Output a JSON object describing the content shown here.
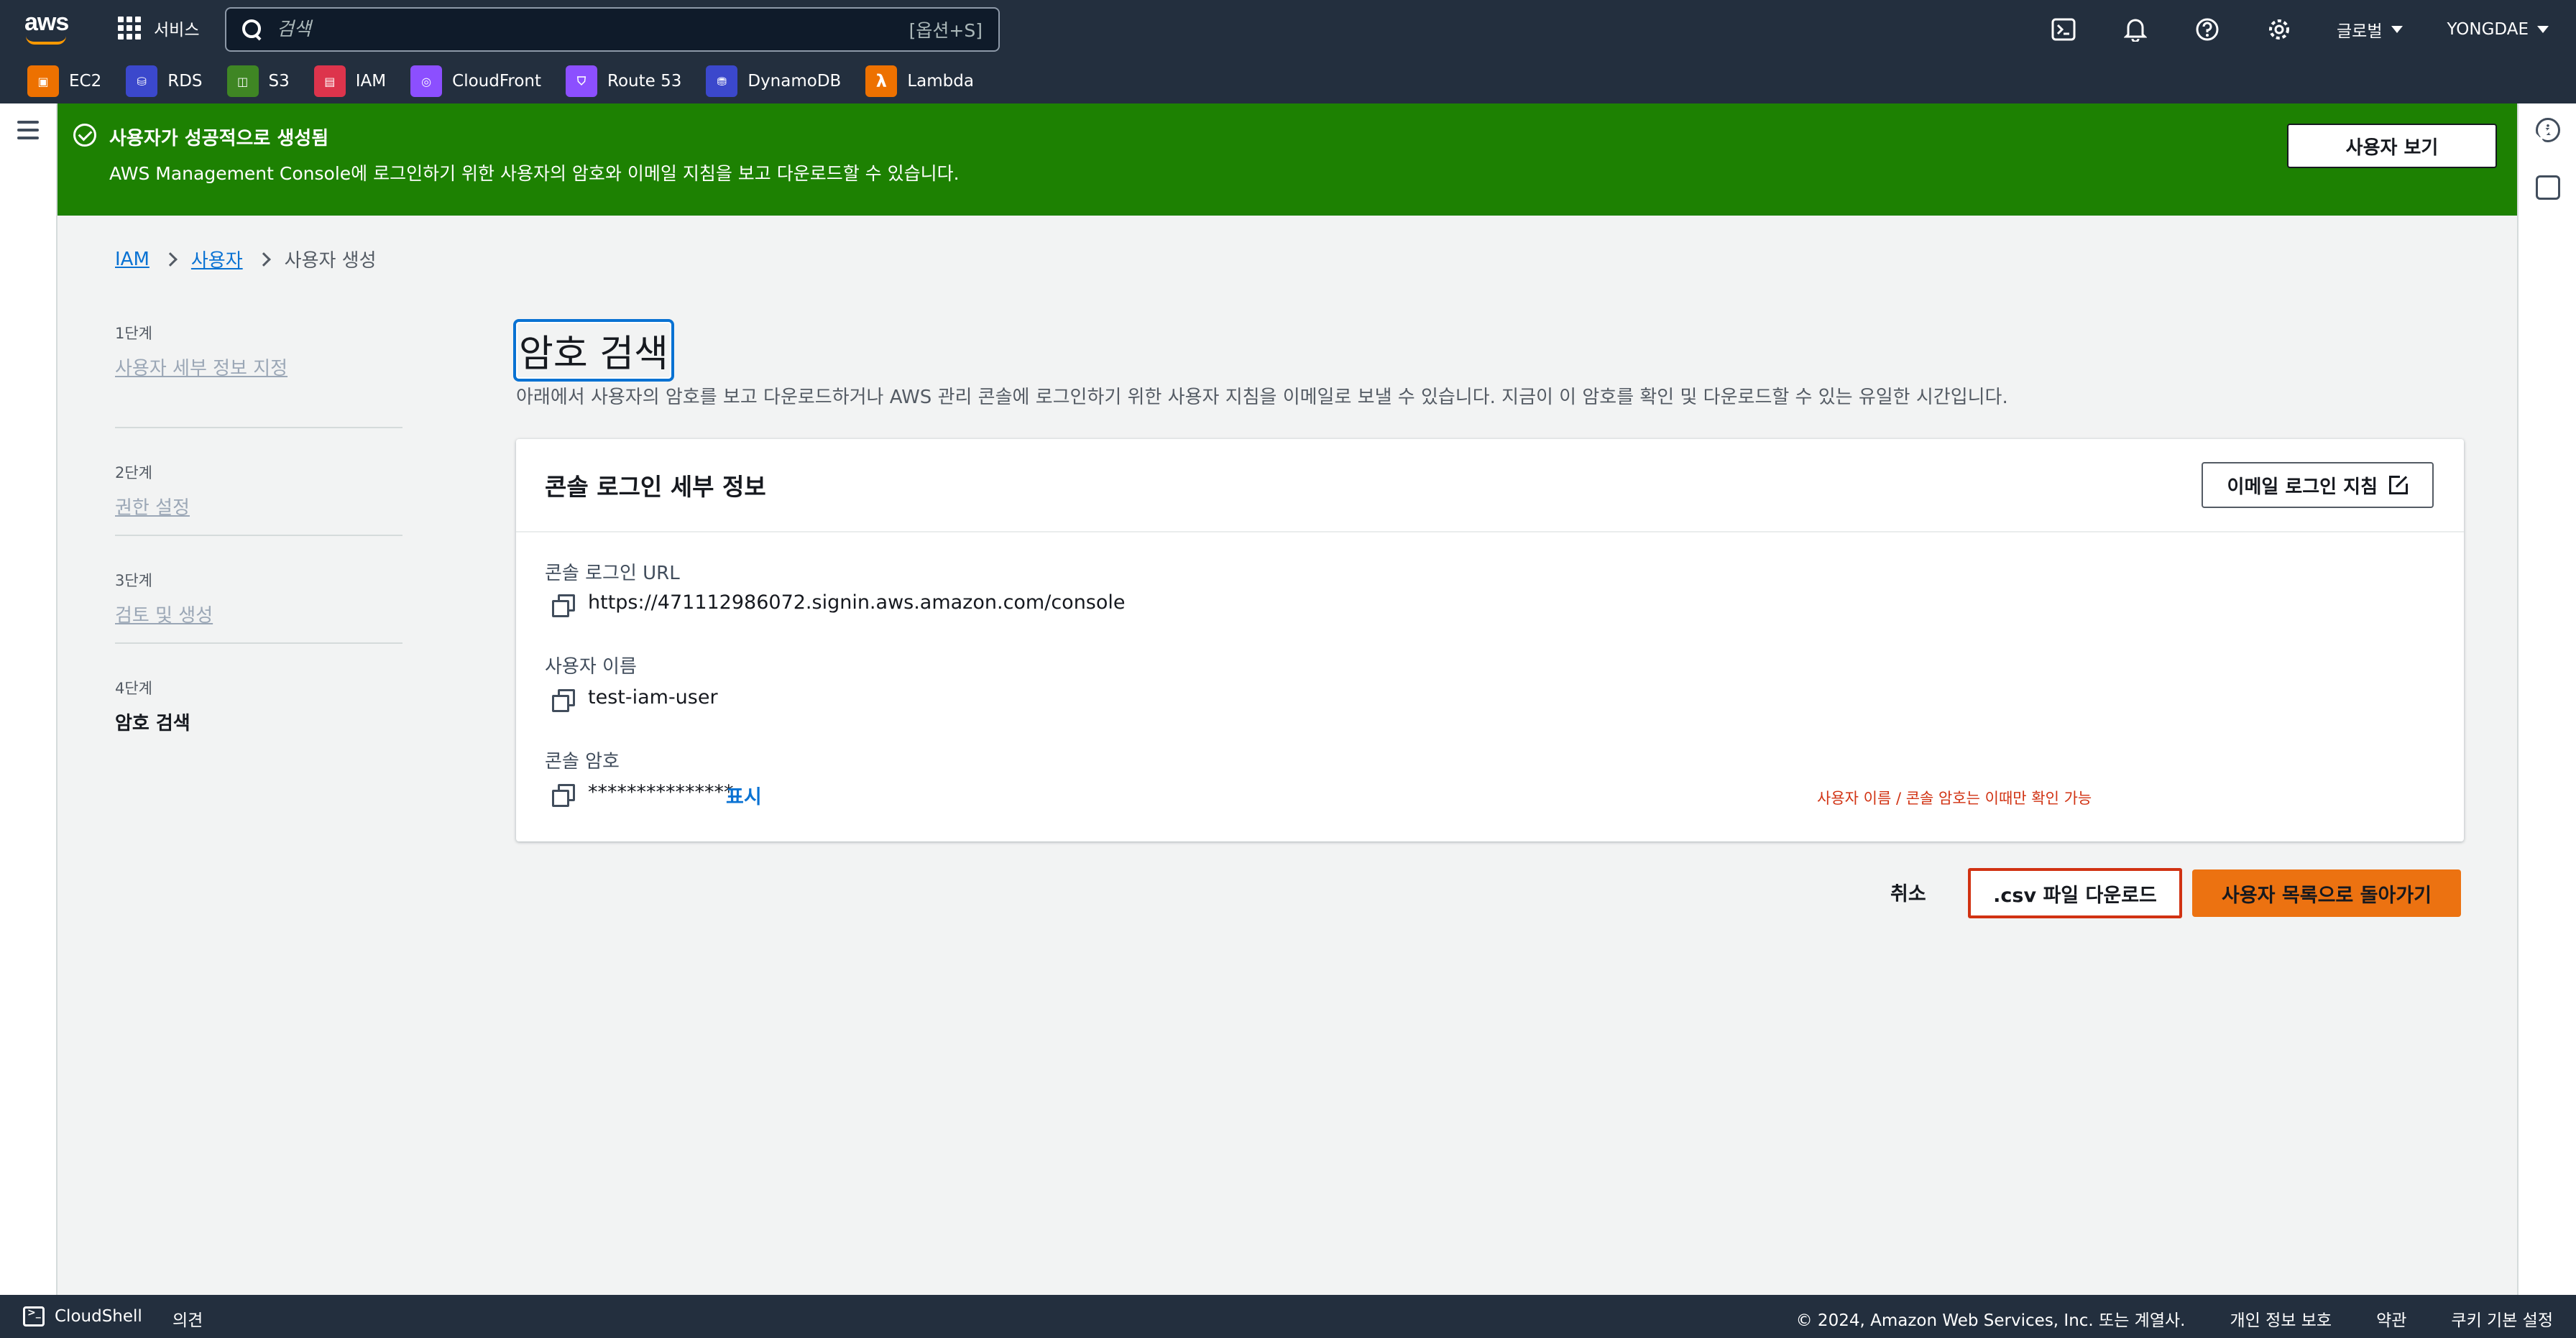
{
  "topnav": {
    "services_label": "서비스",
    "search_placeholder": "검색",
    "search_shortcut": "[옵션+S]",
    "region_label": "글로벌",
    "account_label": "YONGDAE"
  },
  "favorites": [
    {
      "label": "EC2",
      "color": "#ed7100"
    },
    {
      "label": "RDS",
      "color": "#3b48cc"
    },
    {
      "label": "S3",
      "color": "#3f8624"
    },
    {
      "label": "IAM",
      "color": "#dd344c"
    },
    {
      "label": "CloudFront",
      "color": "#8c4fff"
    },
    {
      "label": "Route 53",
      "color": "#8c4fff"
    },
    {
      "label": "DynamoDB",
      "color": "#3b48cc"
    },
    {
      "label": "Lambda",
      "color": "#ed7100"
    }
  ],
  "flash": {
    "title": "사용자가 성공적으로 생성됨",
    "description": "AWS Management Console에 로그인하기 위한 사용자의 암호와 이메일 지침을 보고 다운로드할 수 있습니다.",
    "button_label": "사용자 보기"
  },
  "breadcrumb": {
    "items": [
      "IAM",
      "사용자",
      "사용자 생성"
    ]
  },
  "steps": [
    {
      "num": "1단계",
      "label": "사용자 세부 정보 지정"
    },
    {
      "num": "2단계",
      "label": "권한 설정"
    },
    {
      "num": "3단계",
      "label": "검토 및 생성"
    },
    {
      "num": "4단계",
      "label": "암호 검색"
    }
  ],
  "main": {
    "title": "암호 검색",
    "description": "아래에서 사용자의 암호를 보고 다운로드하거나 AWS 관리 콘솔에 로그인하기 위한 사용자 지침을 이메일로 보낼 수 있습니다. 지금이 이 암호를 확인 및 다운로드할 수 있는 유일한 시간입니다."
  },
  "card": {
    "title": "콘솔 로그인 세부 정보",
    "email_button": "이메일 로그인 지침",
    "fields": [
      {
        "label": "콘솔 로그인 URL",
        "value": "https://471112986072.signin.aws.amazon.com/console"
      },
      {
        "label": "사용자 이름",
        "value": "test-iam-user"
      },
      {
        "label": "콘솔 암호",
        "value": "***************"
      }
    ],
    "show_label": "표시",
    "note": "사용자 이름 / 콘솔 암호는 이때만 확인 가능"
  },
  "actions": {
    "cancel": "취소",
    "download_csv": ".csv 파일 다운로드",
    "back_to_list": "사용자 목록으로 돌아가기"
  },
  "footer": {
    "cloudshell": "CloudShell",
    "feedback": "의견",
    "copyright": "© 2024, Amazon Web Services, Inc. 또는 계열사.",
    "privacy": "개인 정보 보호",
    "terms": "약관",
    "cookies": "쿠키 기본 설정"
  }
}
